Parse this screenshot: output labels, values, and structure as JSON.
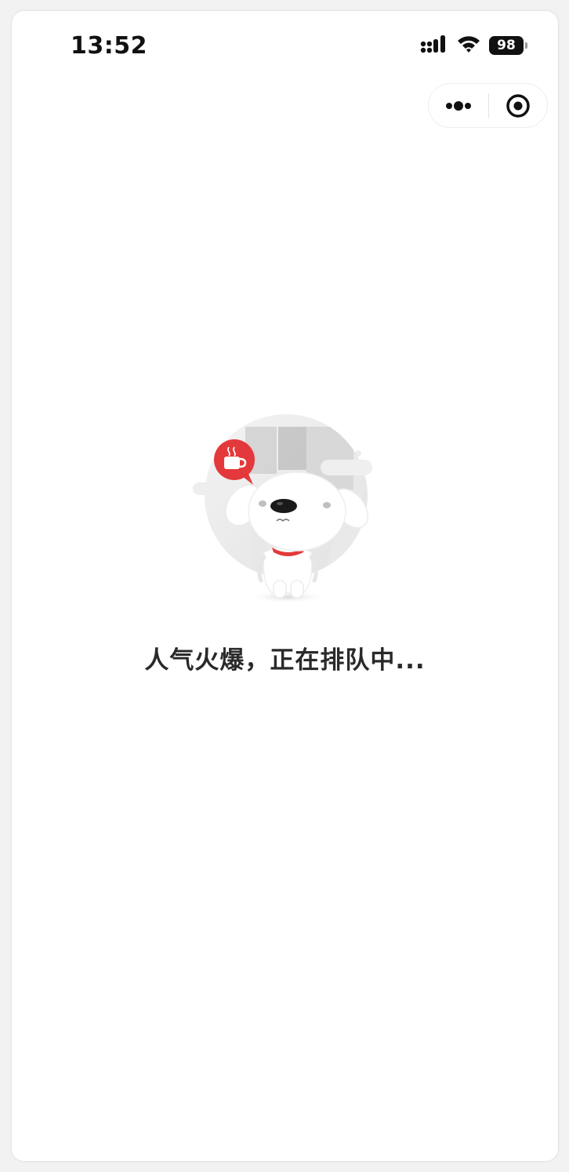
{
  "status_bar": {
    "time": "13:52",
    "battery": "98",
    "icons": [
      "cellular-signal-icon",
      "wifi-icon",
      "battery-icon"
    ]
  },
  "capsule": {
    "icons": [
      "more-dots-icon",
      "close-target-icon"
    ]
  },
  "loading": {
    "message": "人气火爆，正在排队中...",
    "illustration": "mascot-dog-waiting-icon",
    "accent_color": "#e4393c"
  }
}
